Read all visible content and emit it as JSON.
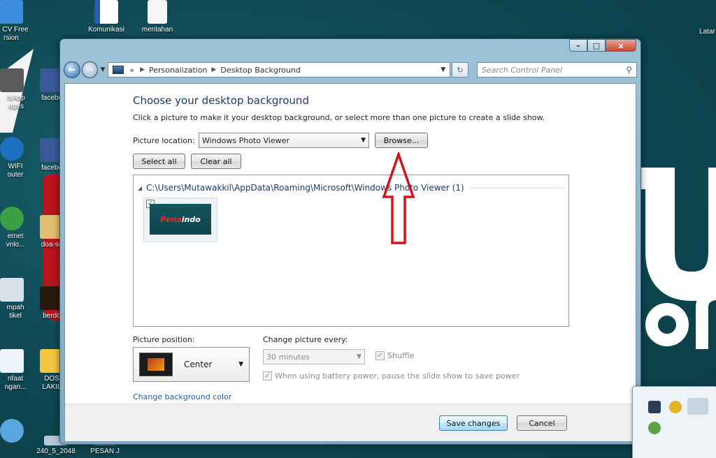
{
  "desktop": {
    "icons": [
      {
        "label": "CV Free",
        "label2": "rsion",
        "color": "#3d8ce0"
      },
      {
        "label": "Komunikasi",
        "label2": "",
        "color": "#2a5aa8"
      },
      {
        "label": "mentahan",
        "label2": "",
        "color": "#f5f5f5"
      },
      {
        "label": "Latar",
        "label2": "",
        "color": "transparent"
      },
      {
        "label": "tsApp",
        "label2": "ages",
        "color": "#5a5a5a"
      },
      {
        "label": "facebo",
        "label2": "",
        "color": "#3b5998"
      },
      {
        "label": "WIFI",
        "label2": "outer",
        "color": "#1d6fbf"
      },
      {
        "label": "facebo",
        "label2": "",
        "color": "#3b5998"
      },
      {
        "label": "ernet",
        "label2": "vnlo...",
        "color": "#3aa043"
      },
      {
        "label": "doa-se",
        "label2": "",
        "color": "#e0c070"
      },
      {
        "label": "mpah",
        "label2": "tikel",
        "color": "#d9e2ea"
      },
      {
        "label": "berdo",
        "label2": "",
        "color": "#2a1a0a"
      },
      {
        "label": "nfaat",
        "label2": "ngan...",
        "color": "#eef4fb"
      },
      {
        "label": "DOS",
        "label2": "LAKIL",
        "color": "#f5c542"
      },
      {
        "label": "240_5_2048",
        "label2": "",
        "color": "#b7c9d9"
      },
      {
        "label": "PESAN J",
        "label2": "",
        "color": "#777"
      }
    ]
  },
  "window": {
    "controls": {
      "minimize": "–",
      "maximize": "□",
      "close": "x"
    },
    "breadcrumb": [
      "Personalization",
      "Desktop Background"
    ],
    "breadcrumb_prefix": "«",
    "search_placeholder": "Search Control Panel",
    "title": "Choose your desktop background",
    "description": "Click a picture to make it your desktop background, or select more than one picture to create a slide show.",
    "picture_location_label": "Picture location:",
    "picture_location_value": "Windows Photo Viewer",
    "browse_label": "Browse...",
    "select_all_label": "Select all",
    "clear_all_label": "Clear all",
    "group_header": "C:\\Users\\Mutawakkil\\AppData\\Roaming\\Microsoft\\Windows Photo Viewer (1)",
    "thumbnail": {
      "text_a": "Pena",
      "text_b": "indo",
      "checked": true
    },
    "picture_position_label": "Picture position:",
    "picture_position_value": "Center",
    "change_every_label": "Change picture every:",
    "change_every_value": "30 minutes",
    "shuffle_label": "Shuffle",
    "battery_label": "When using battery power, pause the slide show to save power",
    "bg_color_link": "Change background color",
    "save_label": "Save changes",
    "cancel_label": "Cancel"
  },
  "colors": {
    "link": "#1d5ea7",
    "title": "#1e3a6b",
    "annotation": "#d0141c"
  }
}
